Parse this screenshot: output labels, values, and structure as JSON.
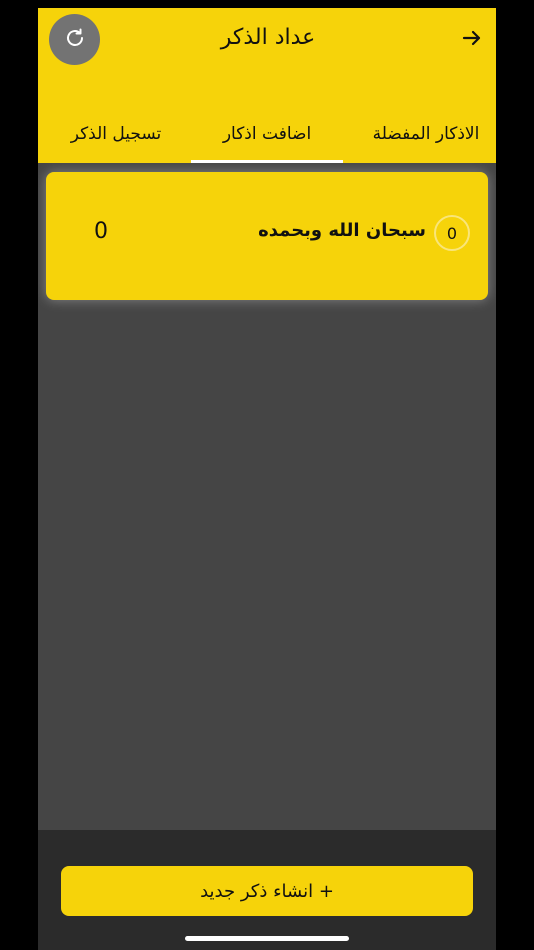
{
  "header": {
    "title": "عداد الذكر",
    "refresh_icon": "refresh-icon",
    "back_icon": "arrow-right-icon",
    "colors": {
      "accent": "#f6d30a",
      "refresh_bg": "#737373"
    }
  },
  "tabs": [
    {
      "label": "تسجيل الذكر",
      "active": false
    },
    {
      "label": "اضافت اذكار",
      "active": true
    },
    {
      "label": "الاذكار المفضلة",
      "active": false
    }
  ],
  "zikr_list": [
    {
      "text": "سبحان الله وبحمده",
      "count": "0",
      "total": "0"
    }
  ],
  "footer": {
    "create_label": "+ انشاء ذكر جديد"
  }
}
